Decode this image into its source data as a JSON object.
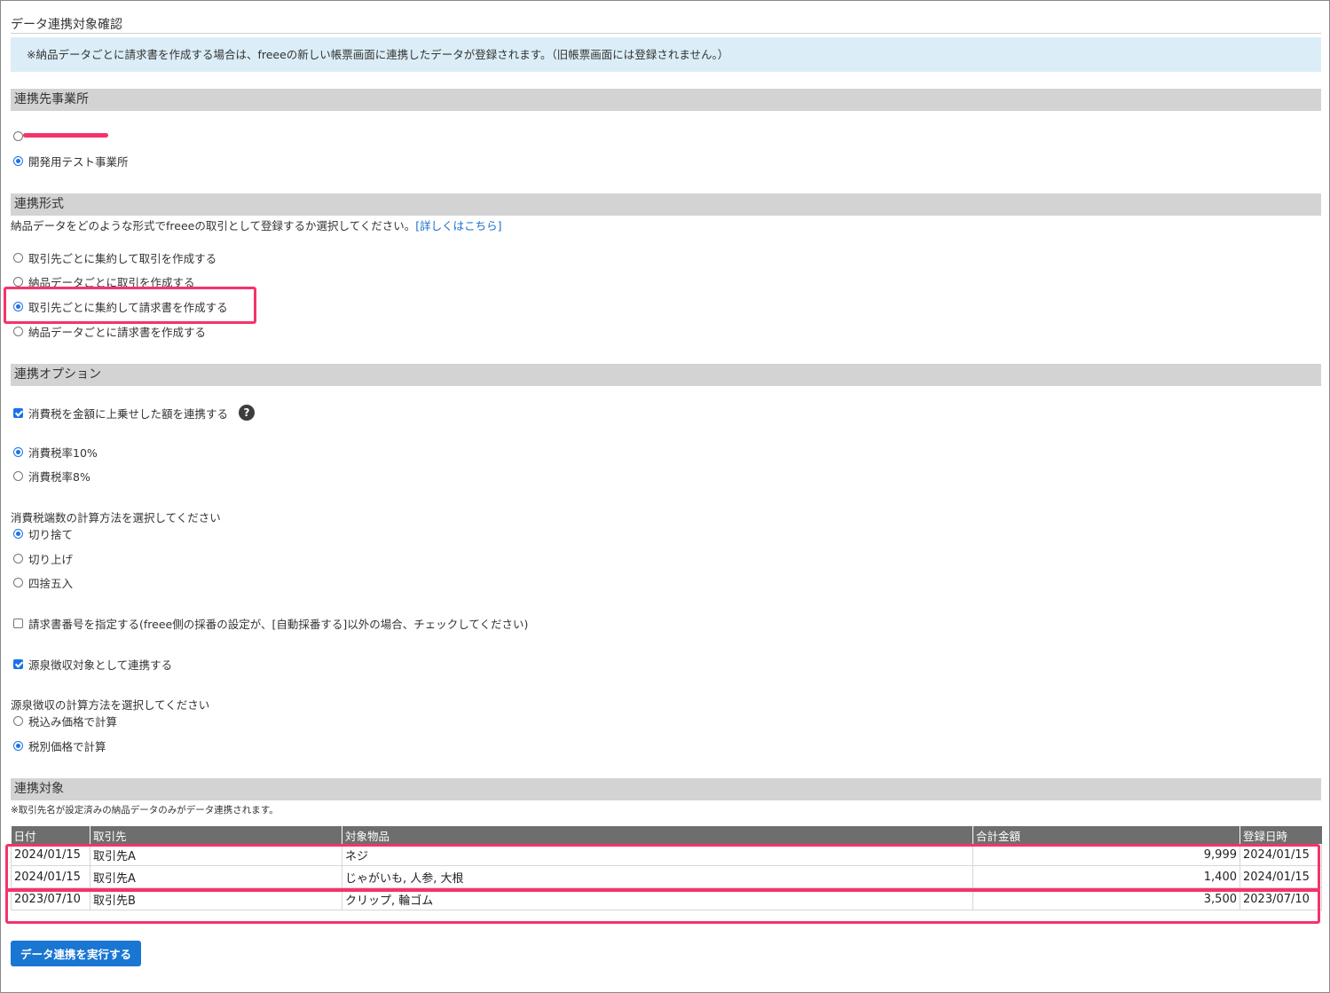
{
  "page_title": "データ連携対象確認",
  "notice": "※納品データごとに請求書を作成する場合は、freeeの新しい帳票画面に連携したデータが登録されます。（旧帳票画面には登録されません。）",
  "office": {
    "heading": "連携先事業所",
    "options": [
      {
        "label": "",
        "selected": false
      },
      {
        "label": "開発用テスト事業所",
        "selected": true
      }
    ]
  },
  "format": {
    "heading": "連携形式",
    "description": "納品データをどのような形式でfreeeの取引として登録するか選択してください。",
    "detail_link": "[詳しくはこちら]",
    "options": [
      {
        "label": "取引先ごとに集約して取引を作成する",
        "selected": false
      },
      {
        "label": "納品データごとに取引を作成する",
        "selected": false
      },
      {
        "label": "取引先ごとに集約して請求書を作成する",
        "selected": true
      },
      {
        "label": "納品データごとに請求書を作成する",
        "selected": false
      }
    ]
  },
  "options_section": {
    "heading": "連携オプション",
    "tax_add_label": "消費税を金額に上乗せした額を連携する",
    "tax_add_checked": true,
    "help_glyph": "?",
    "tax_rates": [
      {
        "label": "消費税率10%",
        "selected": true
      },
      {
        "label": "消費税率8%",
        "selected": false
      }
    ],
    "rounding_label": "消費税端数の計算方法を選択してください",
    "rounding": [
      {
        "label": "切り捨て",
        "selected": true
      },
      {
        "label": "切り上げ",
        "selected": false
      },
      {
        "label": "四捨五入",
        "selected": false
      }
    ],
    "invoice_number_label": "請求書番号を指定する(freee側の採番の設定が、[自動採番する]以外の場合、チェックしてください)",
    "invoice_number_checked": false,
    "withholding_label": "源泉徴収対象として連携する",
    "withholding_checked": true,
    "withholding_calc_label": "源泉徴収の計算方法を選択してください",
    "withholding_calc": [
      {
        "label": "税込み価格で計算",
        "selected": false
      },
      {
        "label": "税別価格で計算",
        "selected": true
      }
    ]
  },
  "target": {
    "heading": "連携対象",
    "note": "※取引先名が設定済みの納品データのみがデータ連携されます。",
    "columns": [
      "日付",
      "取引先",
      "対象物品",
      "合計金額",
      "登録日時"
    ],
    "rows": [
      {
        "date": "2024/01/15",
        "client": "取引先A",
        "items": "ネジ",
        "total": "9,999",
        "registered": "2024/01/15"
      },
      {
        "date": "2024/01/15",
        "client": "取引先A",
        "items": "じゃがいも, 人参, 大根",
        "total": "1,400",
        "registered": "2024/01/15"
      },
      {
        "date": "2023/07/10",
        "client": "取引先B",
        "items": "クリップ, 輪ゴム",
        "total": "3,500",
        "registered": "2023/07/10"
      }
    ]
  },
  "execute_button": "データ連携を実行する",
  "colors": {
    "accent": "#1976d2",
    "highlight": "#f5336b",
    "notice_bg": "#dbeef7",
    "section_bg": "#d3d3d3"
  }
}
